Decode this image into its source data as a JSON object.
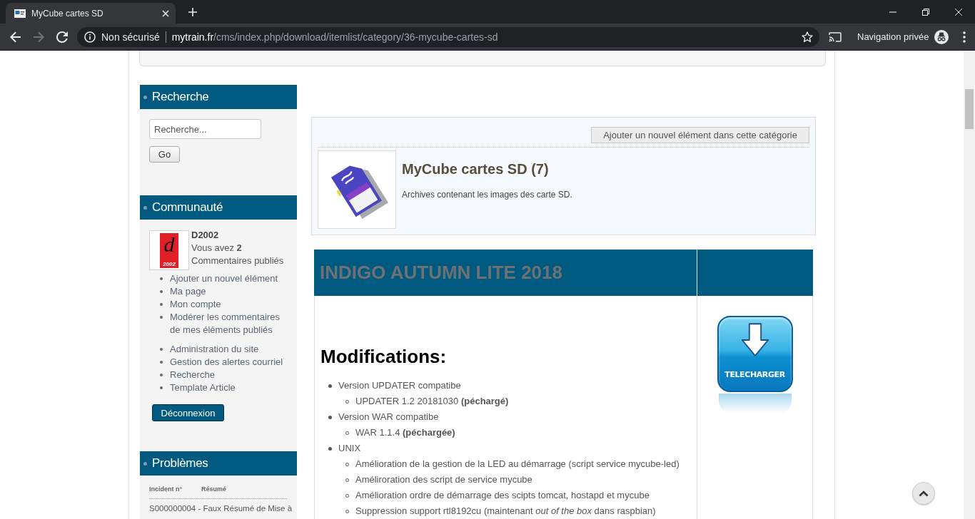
{
  "browser": {
    "tab": {
      "title": "MyCube cartes SD",
      "selected": true
    },
    "nav": [
      {
        "kind": "back",
        "disabled": false
      },
      {
        "kind": "forward",
        "disabled": true
      },
      {
        "kind": "reload",
        "disabled": false
      }
    ],
    "address": {
      "security": "Non sécurisé",
      "host": "mytrain.fr",
      "path": "/cms/index.php/download/itemlist/category/36-mycube-cartes-sd"
    },
    "profile": "Navigation privée"
  },
  "sidebar": [
    {
      "kind": "search",
      "title": "Recherche",
      "placeholder": "Recherche...",
      "button": "Go"
    },
    {
      "kind": "community",
      "title": "Communauté",
      "avatar": {
        "letter": "d",
        "year": "2002"
      },
      "user": "D2002",
      "summary": "Vous avez **2** Commentaires publiés",
      "link_groups": [
        [
          "Ajouter un nouvel élément",
          "Ma page",
          "Mon compte",
          "Modérer les commentaires de mes éléments publiés"
        ],
        [
          "Administration du site",
          "Gestion des alertes courriel",
          "Recherche",
          "Template Article"
        ]
      ],
      "button": "Déconnexion"
    },
    {
      "kind": "issues",
      "title": "Problèmes",
      "columns": [
        "Incident n°",
        "Résumé"
      ],
      "rows": [
        "S000000004 - Faux Résumé de Mise à"
      ]
    }
  ],
  "category": {
    "add_button": "Ajouter un nouvel élément dans cette catégorie",
    "title": "MyCube cartes SD (7)",
    "description": "Archives contenant les images des carte SD."
  },
  "item": {
    "title": "INDIGO AUTUMN LITE 2018",
    "heading": "Modifications:",
    "download": "TELECHARGER",
    "changes": [
      {
        "text": "Version UPDATER compatibe",
        "children": [
          {
            "text": "UPDATER 1.2 20181030 **(péchargé)**"
          }
        ]
      },
      {
        "text": "Version WAR compatibe",
        "children": [
          {
            "text": "WAR 1.1.4 **(péchargée)**"
          }
        ]
      },
      {
        "text": "UNIX",
        "children": [
          {
            "text": "Amélioration de la gestion de la LED au démarrage (script service mycube-led)"
          },
          {
            "text": "Améliroration des script de service mycube"
          },
          {
            "text": "Amélioration ordre de démarrage des scipts tomcat, hostapd et mycube"
          },
          {
            "text": "Suppression support rtl8192cu (maintenant *out of the box* dans raspbian)"
          }
        ]
      }
    ]
  }
}
